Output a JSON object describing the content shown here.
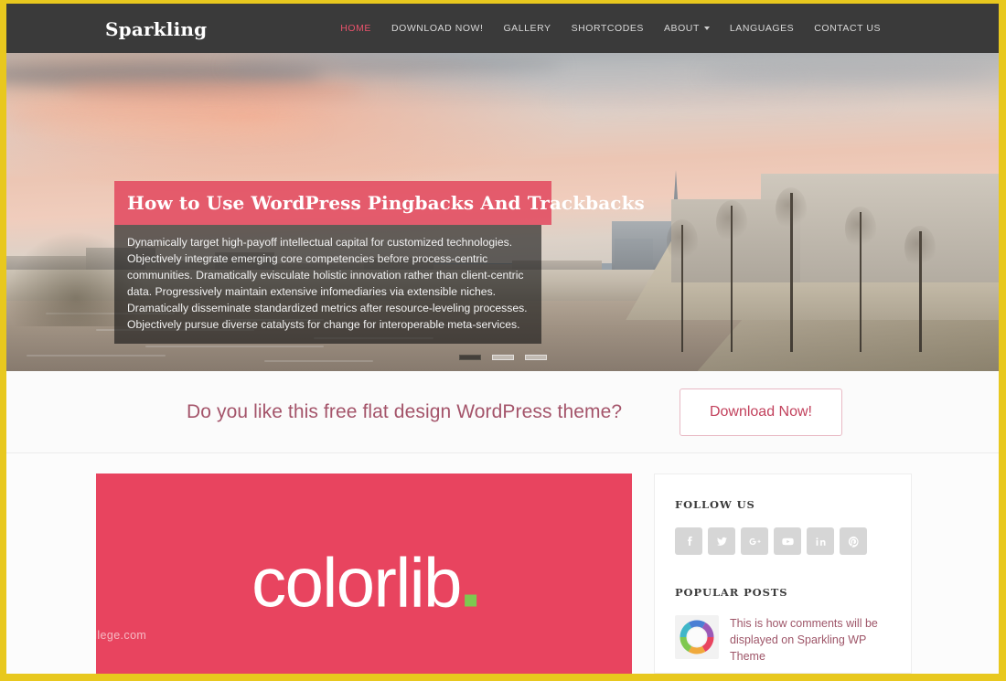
{
  "header": {
    "logo": "Sparkling",
    "nav": [
      {
        "label": "HOME",
        "active": true,
        "caret": false
      },
      {
        "label": "DOWNLOAD NOW!",
        "active": false,
        "caret": false
      },
      {
        "label": "GALLERY",
        "active": false,
        "caret": false
      },
      {
        "label": "SHORTCODES",
        "active": false,
        "caret": false
      },
      {
        "label": "ABOUT",
        "active": false,
        "caret": true
      },
      {
        "label": "LANGUAGES",
        "active": false,
        "caret": false
      },
      {
        "label": "CONTACT US",
        "active": false,
        "caret": false
      }
    ]
  },
  "hero": {
    "slide_title": "How to Use WordPress Pingbacks And Trackbacks",
    "slide_text": "Dynamically target high-payoff intellectual capital for customized technologies. Objectively integrate emerging core competencies before process-centric communities. Dramatically evisculate holistic innovation rather than client-centric data. Progressively maintain extensive infomediaries via extensible niches. Dramatically disseminate standardized metrics after resource-leveling processes. Objectively pursue diverse catalysts for change for interoperable meta-services.",
    "dots": [
      "slide-1",
      "slide-2",
      "slide-3"
    ],
    "active_dot": 0,
    "title_bg": "#e2485e",
    "text_bg": "rgba(20,20,20,0.62)"
  },
  "cta": {
    "text": "Do you like this free flat design WordPress theme?",
    "button": "Download Now!",
    "accent": "#c2415c"
  },
  "main": {
    "post_image_word": "colorlib",
    "post_image_bg": "#e8445f",
    "post_image_dot_color": "#7ec850",
    "watermark": "christiancollege.com"
  },
  "sidebar": {
    "follow_us_title": "FOLLOW US",
    "social": [
      {
        "name": "facebook-icon",
        "label": "Facebook"
      },
      {
        "name": "twitter-icon",
        "label": "Twitter"
      },
      {
        "name": "google-plus-icon",
        "label": "Google Plus"
      },
      {
        "name": "youtube-icon",
        "label": "YouTube"
      },
      {
        "name": "linkedin-icon",
        "label": "LinkedIn"
      },
      {
        "name": "pinterest-icon",
        "label": "Pinterest"
      }
    ],
    "popular_posts_title": "POPULAR POSTS",
    "popular_posts": [
      {
        "title": "This is how comments will be displayed on Sparkling WP Theme"
      }
    ]
  },
  "chrome": {
    "frame_color": "#e8c81e"
  }
}
